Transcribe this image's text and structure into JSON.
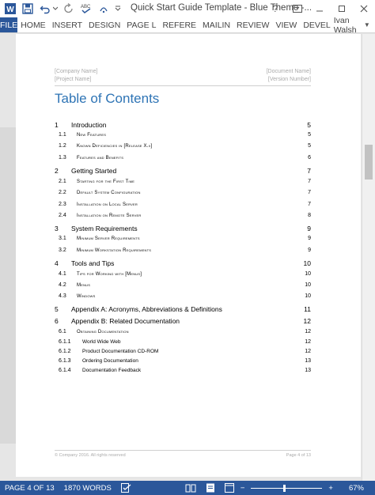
{
  "title_bar": {
    "doc_title": "Quick Start Guide Template - Blue Theme -...",
    "help_label": "?",
    "icons": [
      "word-icon",
      "save-icon",
      "undo-icon",
      "redo-icon",
      "spelling-icon",
      "format-painter-icon",
      "customize-qat-icon"
    ]
  },
  "ribbon": {
    "file_label": "FILE",
    "tabs": [
      "HOME",
      "INSERT",
      "DESIGN",
      "PAGE L",
      "REFERE",
      "MAILIN",
      "REVIEW",
      "VIEW",
      "DEVEL"
    ],
    "user_name": "Ivan Walsh"
  },
  "page": {
    "header_left": [
      "[Company Name]",
      "[Project Name]"
    ],
    "header_right": [
      "[Document Name]",
      "[Version Number]"
    ],
    "toc_title": "Table of Contents",
    "footer_left": "© Company 2016. All rights reserved",
    "footer_right": "Page 4 of 13"
  },
  "toc": [
    {
      "level": 1,
      "num": "1",
      "text": "Introduction",
      "page": "5"
    },
    {
      "level": 2,
      "num": "1.1",
      "text": "New Features",
      "page": "5"
    },
    {
      "level": 2,
      "num": "1.2",
      "text": "Known Deficiencies in [Release X.x]",
      "page": "5"
    },
    {
      "level": 2,
      "num": "1.3",
      "text": "Features and Benefits",
      "page": "6"
    },
    {
      "level": 1,
      "num": "2",
      "text": "Getting Started",
      "page": "7"
    },
    {
      "level": 2,
      "num": "2.1",
      "text": "Starting for the First Time",
      "page": "7"
    },
    {
      "level": 2,
      "num": "2.2",
      "text": "Default System Configuration",
      "page": "7"
    },
    {
      "level": 2,
      "num": "2.3",
      "text": "Installation on Local Server",
      "page": "7"
    },
    {
      "level": 2,
      "num": "2.4",
      "text": "Installation on Remote Server",
      "page": "8"
    },
    {
      "level": 1,
      "num": "3",
      "text": "System Requirements",
      "page": "9"
    },
    {
      "level": 2,
      "num": "3.1",
      "text": "Minimum Server Requirements",
      "page": "9"
    },
    {
      "level": 2,
      "num": "3.2",
      "text": "Minimum Workstation Requirements",
      "page": "9"
    },
    {
      "level": 1,
      "num": "4",
      "text": "Tools and Tips",
      "page": "10"
    },
    {
      "level": 2,
      "num": "4.1",
      "text": "Tips for Working with [Menus]",
      "page": "10"
    },
    {
      "level": 2,
      "num": "4.2",
      "text": "Menus",
      "page": "10"
    },
    {
      "level": 2,
      "num": "4.3",
      "text": "Windows",
      "page": "10"
    },
    {
      "level": 1,
      "num": "5",
      "text": "Appendix A: Acronyms, Abbreviations & Definitions",
      "page": "11"
    },
    {
      "level": 1,
      "num": "6",
      "text": "Appendix B: Related Documentation",
      "page": "12"
    },
    {
      "level": 2,
      "num": "6.1",
      "text": "Obtaining Documentation",
      "page": "12"
    },
    {
      "level": 3,
      "num": "6.1.1",
      "text": "World Wide Web",
      "page": "12"
    },
    {
      "level": 3,
      "num": "6.1.2",
      "text": "Product Documentation CD-ROM",
      "page": "12"
    },
    {
      "level": 3,
      "num": "6.1.3",
      "text": "Ordering Documentation",
      "page": "13"
    },
    {
      "level": 3,
      "num": "6.1.4",
      "text": "Documentation Feedback",
      "page": "13"
    }
  ],
  "status_bar": {
    "page_info": "PAGE 4 OF 13",
    "word_count": "1870 WORDS",
    "zoom_minus": "−",
    "zoom_plus": "+",
    "zoom_level": "67%",
    "zoom_fraction": 0.45
  },
  "colors": {
    "accent": "#2b579a",
    "toc_title": "#2e74b5"
  }
}
